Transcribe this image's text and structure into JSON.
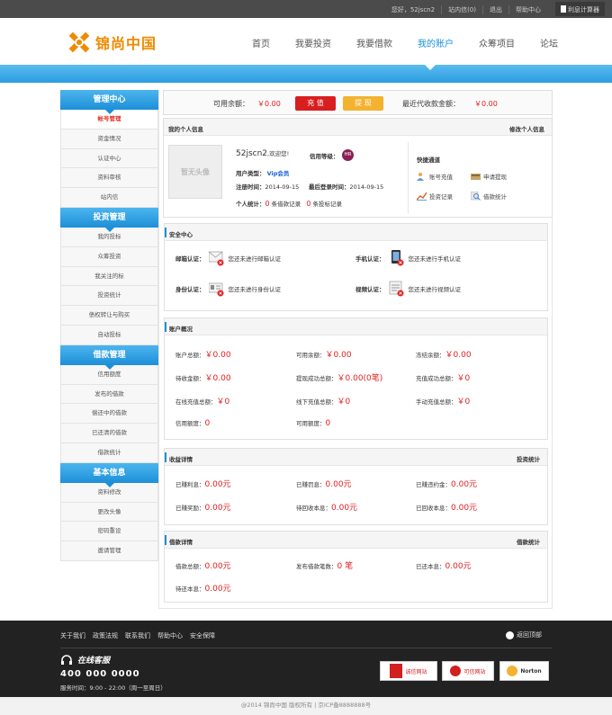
{
  "topbar": {
    "greeting": "您好，52jscn2",
    "inbox": "站内信(0)",
    "logout": "退出",
    "help": "帮助中心",
    "calc": "利息计算器"
  },
  "brand": {
    "name": "锦尚中国",
    "color": "#f08a00"
  },
  "nav": [
    {
      "label": "首页"
    },
    {
      "label": "我要投资"
    },
    {
      "label": "我要借款"
    },
    {
      "label": "我的账户"
    },
    {
      "label": "众筹项目"
    },
    {
      "label": "论坛"
    }
  ],
  "sidebar": [
    {
      "title": "管理中心",
      "items": [
        "帐号管理",
        "资金情况",
        "认证中心",
        "资料审核",
        "站内信"
      ]
    },
    {
      "title": "投资管理",
      "items": [
        "我的投标",
        "众筹投资",
        "我关注的标",
        "投资统计",
        "债权转让与购买",
        "自动投标"
      ]
    },
    {
      "title": "借款管理",
      "items": [
        "信用额度",
        "发布的借款",
        "偿还中的借款",
        "已还清的借款",
        "借款统计"
      ]
    },
    {
      "title": "基本信息",
      "items": [
        "资料修改",
        "更改头像",
        "密码重设",
        "邀请管理"
      ]
    }
  ],
  "balance": {
    "available_label": "可用余额：",
    "available_value": "￥0.00",
    "recharge": "充 值",
    "withdraw": "提 现",
    "recent_label": "最近代收款金额：",
    "recent_value": "￥0.00"
  },
  "profile": {
    "title": "我的个人信息",
    "edit": "修改个人信息",
    "avatar_text": "暂无头像",
    "username": "52jscn2",
    "welcome": ",欢迎您!",
    "credit_label": "信用等级：",
    "credit_badge": "HR",
    "type_label": "用户类型：",
    "type_value": "Vip会员",
    "reg_label": "注册时间：",
    "reg_value": "2014-09-15",
    "last_label": "最后登录时间：",
    "last_value": "2014-09-15",
    "stat_label": "个人统计：",
    "stat_loan_num": "0",
    "stat_loan_txt": "条借款记录",
    "stat_bid_num": "0",
    "stat_bid_txt": "条投标记录",
    "quick_title": "快捷通道",
    "quick": [
      "账号充值",
      "申请提现",
      "投资记录",
      "借款统计"
    ]
  },
  "security": {
    "title": "安全中心",
    "items": [
      {
        "label": "邮箱认证：",
        "status": "您还未进行邮箱认证"
      },
      {
        "label": "手机认证：",
        "status": "您还未进行手机认证"
      },
      {
        "label": "身份认证：",
        "status": "您还未进行身份认证"
      },
      {
        "label": "视频认证：",
        "status": "您还未进行视频认证"
      }
    ]
  },
  "account": {
    "title": "账户概况",
    "cells": [
      {
        "label": "账户总额：",
        "value": "￥0.00"
      },
      {
        "label": "可用余额：",
        "value": "￥0.00"
      },
      {
        "label": "冻结余额：",
        "value": "￥0.00"
      },
      {
        "label": "待收金额：",
        "value": "￥0.00"
      },
      {
        "label": "提现成功总额：",
        "value": "￥0.00(0笔)"
      },
      {
        "label": "充值成功总额：",
        "value": "￥0"
      },
      {
        "label": "在线充值总额：",
        "value": "￥0"
      },
      {
        "label": "线下充值总额：",
        "value": "￥0"
      },
      {
        "label": "手动充值总额：",
        "value": "￥0"
      },
      {
        "label": "信用额度：",
        "value": "0"
      },
      {
        "label": "可用额度：",
        "value": "0"
      }
    ]
  },
  "income": {
    "title": "收益详情",
    "link": "投资统计",
    "cells": [
      {
        "label": "已赚利息：",
        "value": "0.00元"
      },
      {
        "label": "已赚罚息：",
        "value": "0.00元"
      },
      {
        "label": "已赚违约金：",
        "value": "0.00元"
      },
      {
        "label": "已赚奖励：",
        "value": "0.00元"
      },
      {
        "label": "待回收本息：",
        "value": "0.00元"
      },
      {
        "label": "已回收本息：",
        "value": "0.00元"
      }
    ]
  },
  "loan": {
    "title": "借款详情",
    "link": "借款统计",
    "cells": [
      {
        "label": "借款总额：",
        "value": "0.00元"
      },
      {
        "label": "发布借款笔数：",
        "value": "0 笔"
      },
      {
        "label": "已还本息：",
        "value": "0.00元"
      },
      {
        "label": "待还本息：",
        "value": "0.00元"
      }
    ]
  },
  "footer": {
    "links": [
      "关于我们",
      "政策法规",
      "联系我们",
      "帮助中心",
      "安全保障"
    ],
    "back_top": "返回顶部",
    "service": "在线客服",
    "tel": "400 000 0000",
    "hours": "服务时间：9:00 - 22:00（周一至周日）",
    "badges": [
      "诚信网站",
      "可信网站",
      "Norton"
    ],
    "copyright": "@2014 锦尚中国 版权所有 | 京ICP备8888888号"
  }
}
